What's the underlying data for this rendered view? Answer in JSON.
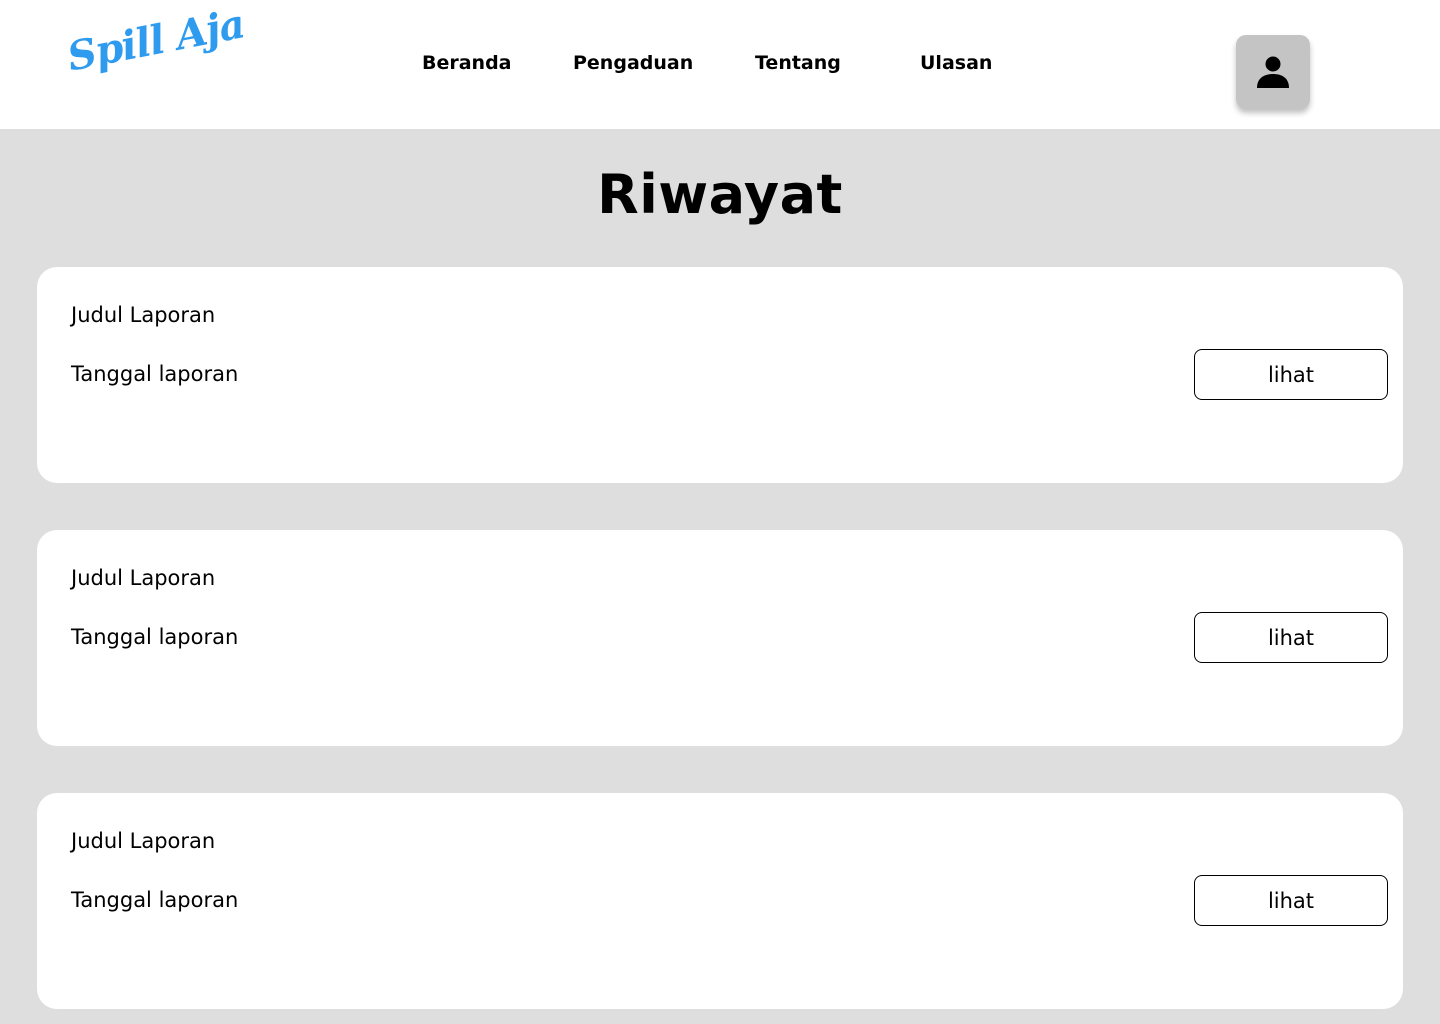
{
  "header": {
    "logo_text": "Spill Aja",
    "logo_color": "#2f9bef",
    "nav": [
      {
        "label": "Beranda"
      },
      {
        "label": "Pengaduan"
      },
      {
        "label": "Tentang"
      },
      {
        "label": "Ulasan"
      }
    ],
    "profile_icon": "user-icon"
  },
  "main": {
    "title": "Riwayat",
    "reports": [
      {
        "title": "Judul Laporan",
        "date": "Tanggal laporan",
        "action_label": "lihat"
      },
      {
        "title": "Judul Laporan",
        "date": "Tanggal laporan",
        "action_label": "lihat"
      },
      {
        "title": "Judul Laporan",
        "date": "Tanggal laporan",
        "action_label": "lihat"
      }
    ]
  },
  "colors": {
    "page_background": "#dedede",
    "card_background": "#ffffff",
    "avatar_background": "#c4c4c4"
  }
}
